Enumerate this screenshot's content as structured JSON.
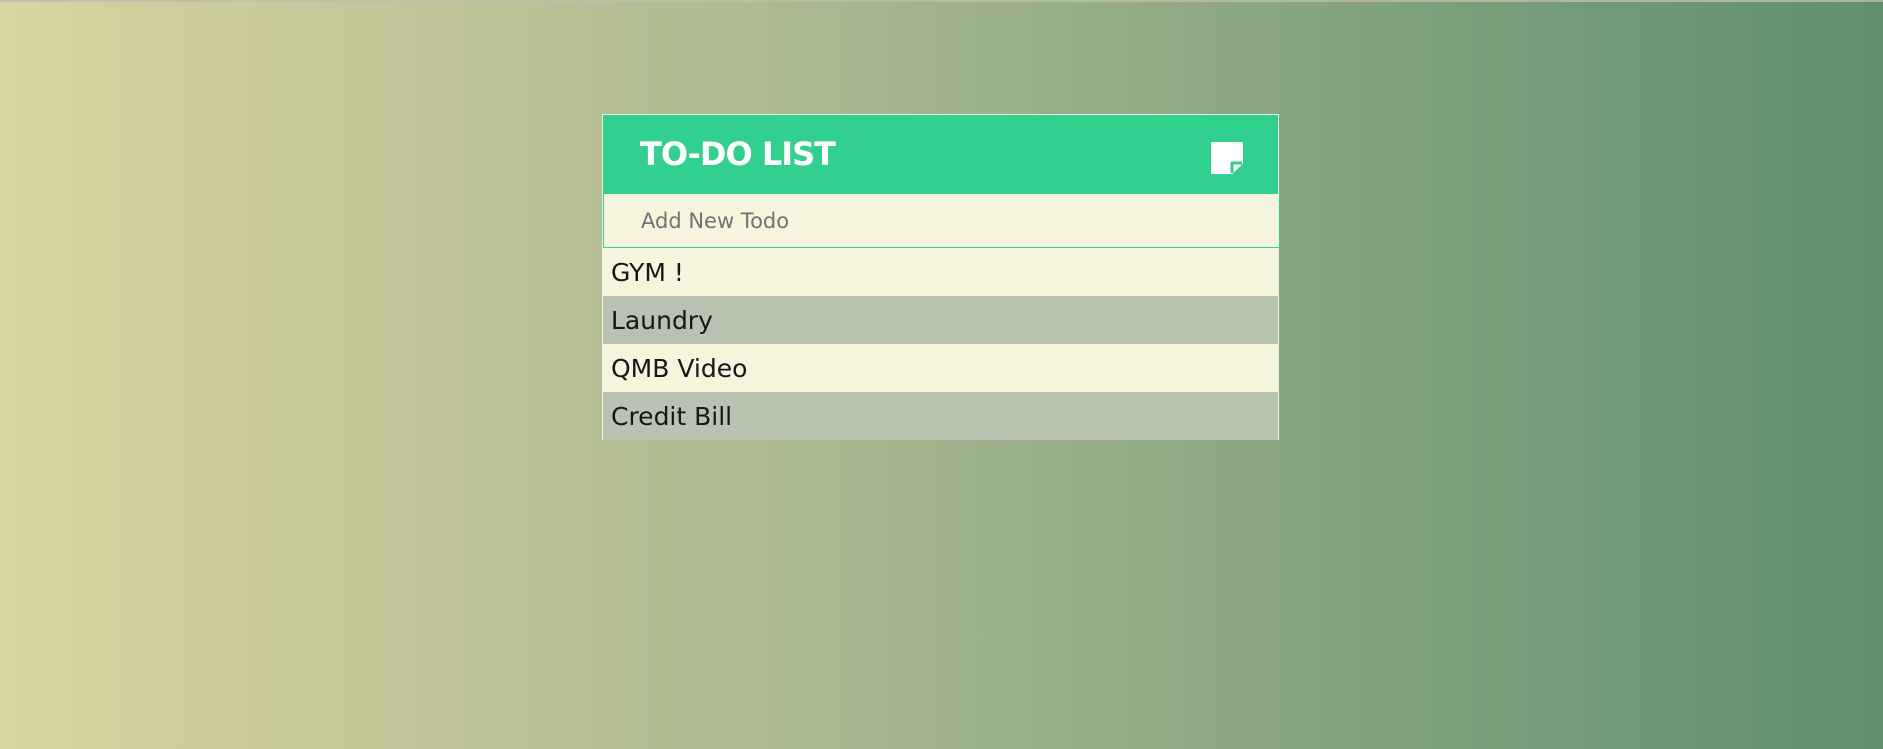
{
  "app": {
    "title": "TO-DO LIST",
    "header_icon": "sticky-note-icon",
    "input": {
      "value": "",
      "placeholder": "Add New Todo"
    }
  },
  "todos": [
    {
      "label": "GYM !"
    },
    {
      "label": "Laundry"
    },
    {
      "label": "QMB Video"
    },
    {
      "label": "Credit Bill"
    }
  ],
  "colors": {
    "header": "#32d08e",
    "item_light": "#f5f4dc",
    "item_dark": "#b8c2b1",
    "text": "#171717"
  }
}
